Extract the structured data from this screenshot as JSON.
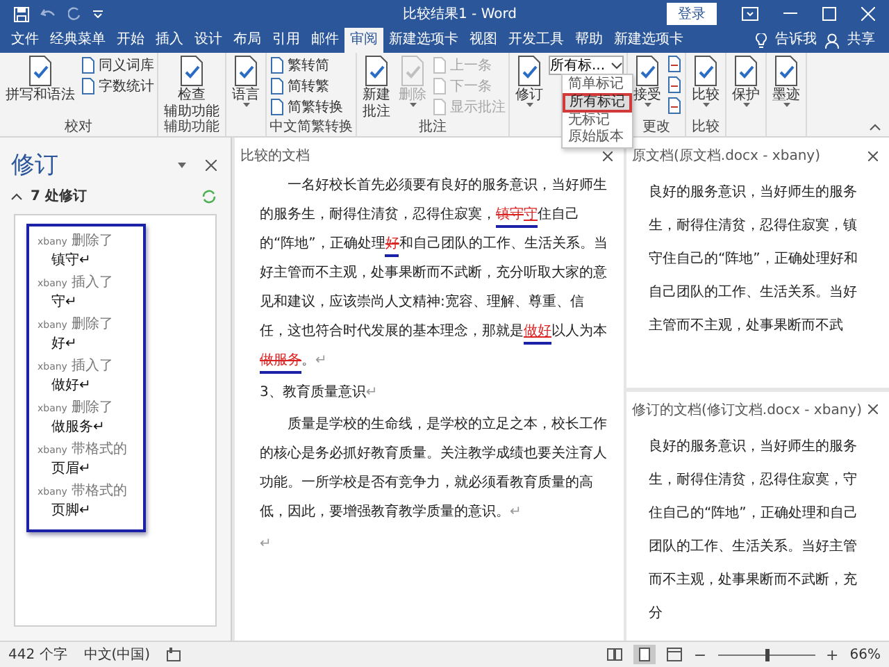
{
  "title_bar": {
    "title": "比较结果1 - Word",
    "login": "登录"
  },
  "tabs": [
    {
      "label": "文件",
      "selected": false
    },
    {
      "label": "经典菜单",
      "selected": false
    },
    {
      "label": "开始",
      "selected": false
    },
    {
      "label": "插入",
      "selected": false
    },
    {
      "label": "设计",
      "selected": false
    },
    {
      "label": "布局",
      "selected": false
    },
    {
      "label": "引用",
      "selected": false
    },
    {
      "label": "邮件",
      "selected": false
    },
    {
      "label": "审阅",
      "selected": true
    },
    {
      "label": "新建选项卡",
      "selected": false
    },
    {
      "label": "视图",
      "selected": false
    },
    {
      "label": "开发工具",
      "selected": false
    },
    {
      "label": "帮助",
      "selected": false
    },
    {
      "label": "新建选项卡",
      "selected": false
    }
  ],
  "tell_me": "告诉我",
  "share": "共享",
  "ribbon": {
    "groups": [
      {
        "label": "校对",
        "items": [
          {
            "kind": "large",
            "label": "拼写和语法",
            "disabled": false
          },
          {
            "kind": "small",
            "label": "同义词库",
            "disabled": false
          },
          {
            "kind": "small",
            "label": "字数统计",
            "disabled": false
          }
        ]
      },
      {
        "label": "辅助功能",
        "items": [
          {
            "kind": "large",
            "label": [
              "检查",
              "辅助功能"
            ],
            "disabled": false
          }
        ]
      },
      {
        "items": [
          {
            "kind": "large",
            "label": "语言",
            "has_menu": true,
            "disabled": false
          }
        ]
      },
      {
        "label": "中文简繁转换",
        "items": [
          {
            "kind": "small",
            "label": "繁转简",
            "disabled": false
          },
          {
            "kind": "small",
            "label": "简转繁",
            "disabled": false
          },
          {
            "kind": "small",
            "label": "简繁转换",
            "disabled": false
          }
        ]
      },
      {
        "label": "批注",
        "items": [
          {
            "kind": "large",
            "label": [
              "新建",
              "批注"
            ],
            "disabled": false
          },
          {
            "kind": "large",
            "label": "删除",
            "has_menu": true,
            "disabled": true
          },
          {
            "kind": "small",
            "label": "上一条",
            "disabled": true
          },
          {
            "kind": "small",
            "label": "下一条",
            "disabled": true
          },
          {
            "kind": "small",
            "label": "显示批注",
            "disabled": true
          }
        ]
      },
      {
        "items": [
          {
            "kind": "large",
            "label": "修订",
            "has_menu": true,
            "disabled": false
          },
          {
            "kind": "combo",
            "value": "所有标..."
          }
        ]
      },
      {
        "label": "更改",
        "items": [
          {
            "kind": "large",
            "label": "接受",
            "has_menu": true,
            "disabled": false
          },
          {
            "kind": "icon"
          },
          {
            "kind": "icon"
          },
          {
            "kind": "icon"
          }
        ]
      },
      {
        "label": "比较",
        "items": [
          {
            "kind": "large",
            "label": "比较",
            "has_menu": true,
            "disabled": false
          }
        ]
      },
      {
        "items": [
          {
            "kind": "large",
            "label": "保护",
            "has_menu": true,
            "disabled": false
          }
        ]
      },
      {
        "items": [
          {
            "kind": "large",
            "label": "墨迹",
            "has_menu": true,
            "disabled": false
          }
        ]
      }
    ]
  },
  "markup_menu": {
    "items": [
      {
        "label": "简单标记",
        "selected": false
      },
      {
        "label": "所有标记",
        "selected": true
      },
      {
        "label": "无标记",
        "selected": false
      },
      {
        "label": "原始版本",
        "selected": false
      }
    ]
  },
  "revisions_pane": {
    "title": "修订",
    "summary": "7 处修订",
    "items": [
      {
        "author": "xbany",
        "action": "删除了",
        "text": "镇守↵"
      },
      {
        "author": "xbany",
        "action": "插入了",
        "text": "守↵"
      },
      {
        "author": "xbany",
        "action": "删除了",
        "text": "好↵"
      },
      {
        "author": "xbany",
        "action": "插入了",
        "text": "做好↵"
      },
      {
        "author": "xbany",
        "action": "删除了",
        "text": "做服务↵"
      },
      {
        "author": "xbany",
        "action": "带格式的",
        "text": "页眉↵"
      },
      {
        "author": "xbany",
        "action": "带格式的",
        "text": "页脚↵"
      }
    ]
  },
  "compared_doc": {
    "title": "比较的文档",
    "paragraphs": [
      {
        "indent": true,
        "segments": [
          {
            "kind": "plain",
            "text": "一名好校长首先必须要有良好的服务意识，当好师生的服务生，耐得住清贫，忍得住寂寞，",
            "marked": false
          },
          {
            "kind": "deleted",
            "text": "镇守",
            "marked": true
          },
          {
            "kind": "inserted",
            "text": "守",
            "marked": true
          },
          {
            "kind": "plain",
            "text": "住自己的“阵地”，正确处理",
            "marked": false
          },
          {
            "kind": "deleted",
            "text": "好",
            "marked": true
          },
          {
            "kind": "plain",
            "text": "和自己团队的工作、生活关系。当好主管而不主观，处事果断而不武断，充分听取大家的意见和建议，应该崇尚人文精神:宽容、理解、尊重、信任，这也符合时代发展的基本理念，那就是",
            "marked": false
          },
          {
            "kind": "inserted",
            "text": "做好",
            "marked": true
          },
          {
            "kind": "plain",
            "text": "以人为本",
            "marked": false
          },
          {
            "kind": "deleted",
            "text": "做服务",
            "marked": true
          },
          {
            "kind": "plain",
            "text": "。",
            "marked": false
          },
          {
            "kind": "mark",
            "text": "↵",
            "marked": false
          }
        ]
      },
      {
        "indent": false,
        "segments": [
          {
            "kind": "plain",
            "text": "3、教育质量意识",
            "marked": false
          },
          {
            "kind": "mark",
            "text": "↵",
            "marked": false
          }
        ]
      },
      {
        "indent": true,
        "segments": [
          {
            "kind": "plain",
            "text": "质量是学校的生命线，是学校的立足之本，校长工作的核心是务必抓好教育质量。关注教学成绩也要关注育人功能。一所学校是否有竞争力，就必须看教育质量的高低，因此，要增强教育教学质量的意识。",
            "marked": false
          },
          {
            "kind": "mark",
            "text": "↵",
            "marked": false
          }
        ]
      },
      {
        "indent": false,
        "segments": [
          {
            "kind": "mark",
            "text": "↵",
            "marked": false
          }
        ]
      }
    ]
  },
  "original_doc": {
    "title": "原文档(原文档.docx - xbany)",
    "text": "良好的服务意识，当好师生的服务生，耐得住清贫，忍得住寂寞，镇守住自己的“阵地”，正确处理好和自己团队的工作、生活关系。当好主管而不主观，处事果断而不武"
  },
  "revised_doc": {
    "title": "修订的文档(修订文档.docx - xbany)",
    "text": "良好的服务意识，当好师生的服务生，耐得住清贫，忍得住寂寞，守住自己的“阵地”，正确处理和自己团队的工作、生活关系。当好主管而不主观，处事果断而不武断，充分"
  },
  "status_bar": {
    "word_count": "442 个字",
    "language": "中文(中国)",
    "zoom_out": "−",
    "zoom_in": "+",
    "zoom_slider": {
      "level": 0.5
    },
    "zoom": "66%"
  }
}
